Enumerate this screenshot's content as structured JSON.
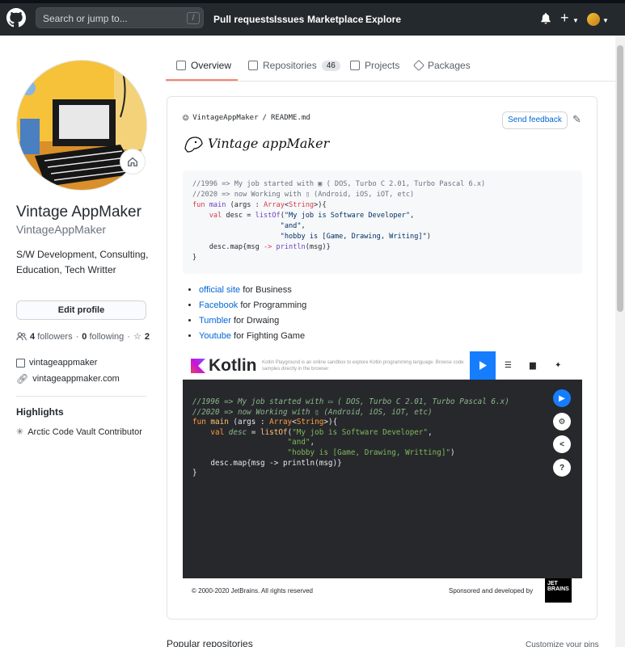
{
  "header": {
    "search_placeholder": "Search or jump to...",
    "slash_key": "/",
    "nav": [
      "Pull requests",
      "Issues",
      "Marketplace",
      "Explore"
    ]
  },
  "tabs": [
    {
      "label": "Overview"
    },
    {
      "label": "Repositories",
      "count": "46"
    },
    {
      "label": "Projects"
    },
    {
      "label": "Packages"
    }
  ],
  "profile": {
    "name": "Vintage AppMaker",
    "login": "VintageAppMaker",
    "bio": "S/W Development, Consulting, Education, Tech Writter",
    "edit_label": "Edit profile",
    "followers": "4",
    "followers_label": "followers",
    "following": "0",
    "following_label": "following",
    "stars": "2",
    "twitter": "vintageappmaker",
    "website": "vintageappmaker.com",
    "highlights_title": "Highlights",
    "highlight": "Arctic Code Vault Contributor"
  },
  "readme": {
    "path_user": "VintageAppMaker",
    "path_sep": "/",
    "path_file": "README.md",
    "feedback_label": "Send feedback",
    "brand": "Vintage appMaker",
    "links": [
      {
        "link": "official site",
        "rest": " for Business"
      },
      {
        "link": "Facebook",
        "rest": " for Programming"
      },
      {
        "link": "Tumbler",
        "rest": " for Drwaing"
      },
      {
        "link": "Youtube",
        "rest": " for Fighting Game"
      }
    ]
  },
  "kotlin": {
    "logo": "Kotlin",
    "tagline": "Kotlin Playground is an online sandbox to explore Kotlin programming language. Browse code samples directly in the browser",
    "copyright": "© 2000-2020 JetBrains. All rights reserved",
    "sponsor": "Sponsored and developed by",
    "jb_logo": "JET BRAINS"
  },
  "footer": {
    "popular": "Popular repositories",
    "customize": "Customize your pins"
  }
}
